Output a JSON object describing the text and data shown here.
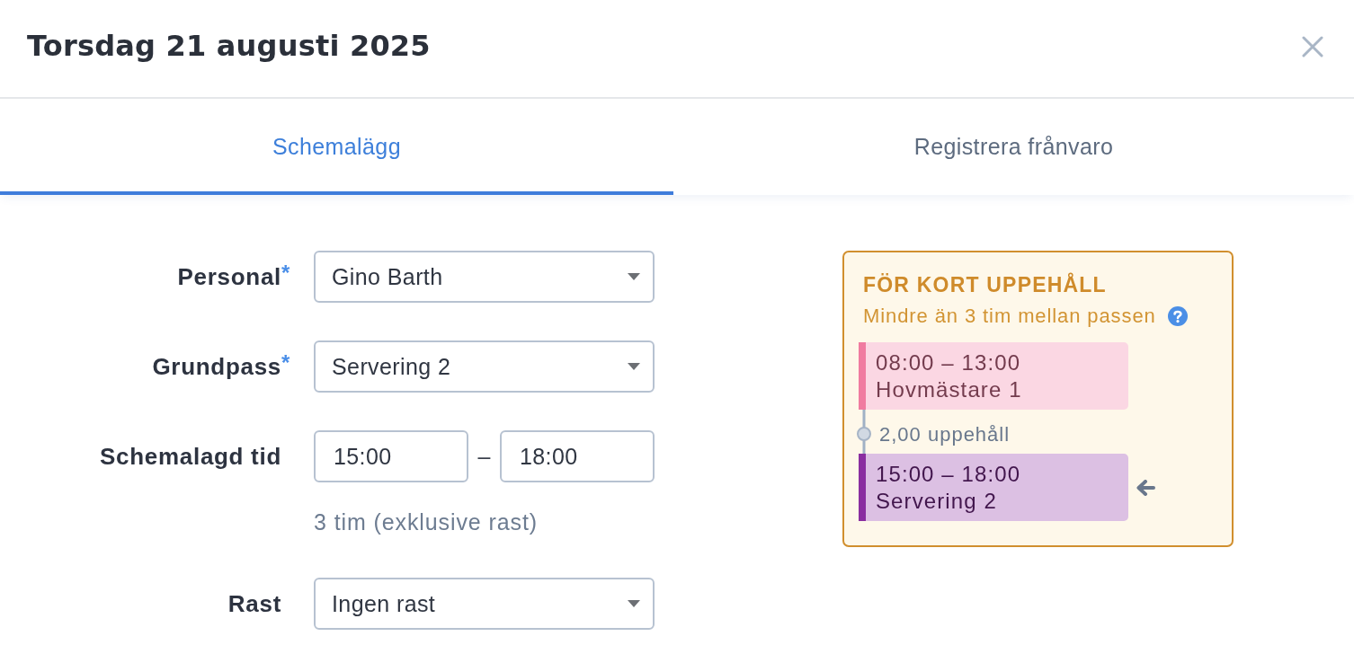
{
  "dialog": {
    "title": "Torsdag 21 augusti 2025"
  },
  "tabs": [
    {
      "label": "Schemalägg",
      "selected": true
    },
    {
      "label": "Registrera frånvaro",
      "selected": false
    }
  ],
  "form": {
    "required_mark": "*",
    "fields": [
      {
        "kind": "select",
        "label": "Personal",
        "required": true,
        "value": "Gino Barth"
      },
      {
        "kind": "select",
        "label": "Grundpass",
        "required": true,
        "value": "Servering 2"
      },
      {
        "kind": "time_range",
        "label": "Schemalagd tid",
        "required": false,
        "start": "15:00",
        "separator": "–",
        "end": "18:00",
        "hint": "3 tim (exklusive rast)"
      },
      {
        "kind": "select",
        "label": "Rast",
        "required": false,
        "value": "Ingen rast"
      }
    ]
  },
  "warning": {
    "title": "FÖR KORT UPPEHÅLL",
    "message": "Mindre än 3 tim mellan passen",
    "shifts": [
      {
        "time": "08:00 – 13:00",
        "name": "Hovmästare 1",
        "color": "#f07ba0",
        "current": false
      },
      {
        "time": "15:00 – 18:00",
        "name": "Servering 2",
        "color": "#8a2ea0",
        "current": true
      }
    ],
    "gap": "2,00 uppehåll"
  }
}
